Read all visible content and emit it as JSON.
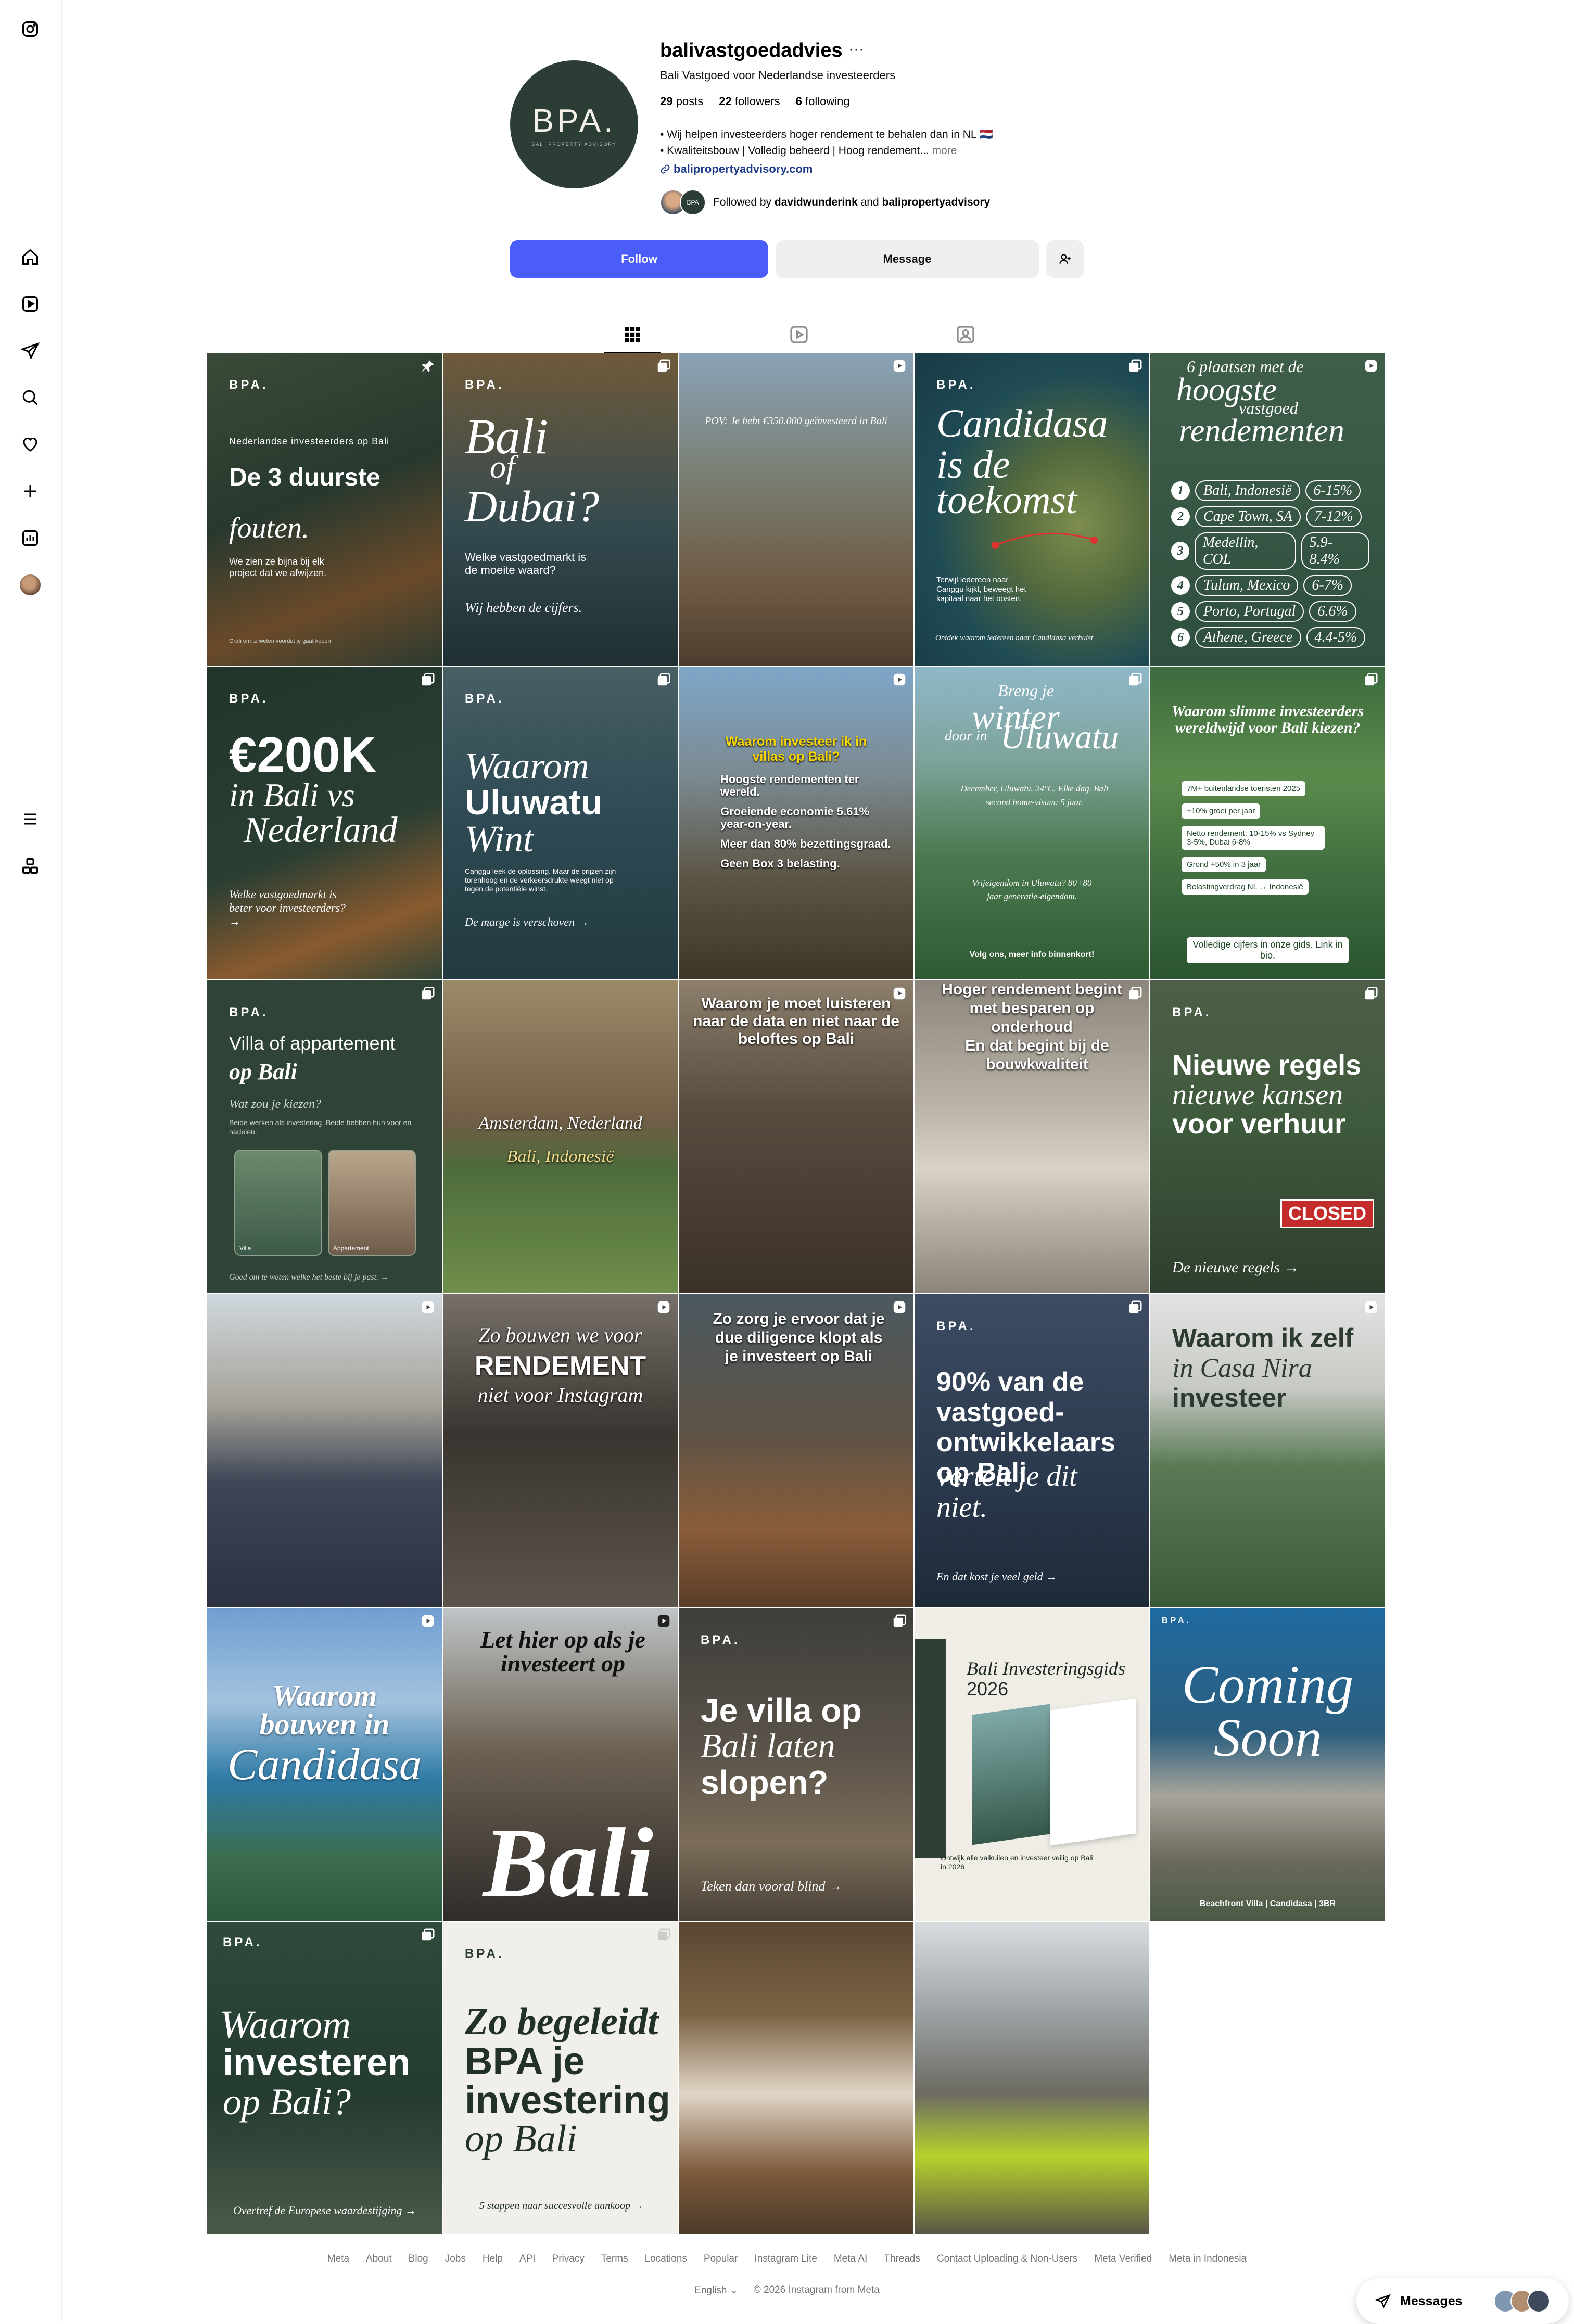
{
  "profile": {
    "username": "balivastgoedadvies",
    "full_name": "Bali Vastgoed voor Nederlandse investeerders",
    "avatar_logo": "BPA.",
    "avatar_sub": "BALI PROPERTY ADVISORY",
    "stats": [
      {
        "value": "29",
        "label": "posts"
      },
      {
        "value": "22",
        "label": "followers"
      },
      {
        "value": "6",
        "label": "following"
      }
    ],
    "bio_line1": "• Wij helpen investeerders hoger rendement te behalen dan in NL 🇳🇱",
    "bio_line2": "• Kwaliteitsbouw | Volledig beheerd | Hoog rendement...",
    "bio_more": "more",
    "link": "balipropertyadvisory.com",
    "followed_prefix": "Followed by",
    "followed_user1": "davidwunderink",
    "followed_and": "and",
    "followed_user2": "balipropertyadvisory",
    "mini_logo": "BPA"
  },
  "buttons": {
    "follow": "Follow",
    "message": "Message"
  },
  "icons": {
    "rail": [
      "instagram-icon",
      "home-icon",
      "reels-icon",
      "send-icon",
      "search-icon",
      "heart-icon",
      "create-icon",
      "dashboard-icon",
      "profile-avatar",
      "menu-icon",
      "also-from-meta-icon"
    ],
    "tabs": [
      "grid-icon",
      "reels-tab-icon",
      "tagged-icon"
    ]
  },
  "posts": [
    {
      "bpa": "BPA.",
      "kicker": "Nederlandse investeerders op Bali",
      "title": "De 3 duurste",
      "title2": "fouten.",
      "sub": "We zien ze bijna bij elk project dat we afwijzen.",
      "foot": "Grafi om te weten voordat je gaat kopen"
    },
    {
      "bpa": "BPA.",
      "title": "Bali",
      "title2": "of",
      "title3": "Dubai?",
      "sub": "Welke vastgoedmarkt is de moeite waard?",
      "foot": "Wij hebben de cijfers."
    },
    {
      "title": "POV: Je hebt €350.000 geïnvesteerd in Bali"
    },
    {
      "bpa": "BPA.",
      "title": "Candidasa",
      "title2": "is de",
      "title3": "toekomst",
      "sub": "Terwijl iedereen naar Canggu kijkt, beweegt het kapitaal naar het oosten.",
      "foot": "Ontdek waarom iedereen naar Candidasa verhuist"
    },
    {
      "title": "6 plaatsen met de",
      "title2": "hoogste",
      "title3": "vastgoed",
      "title4": "rendementen",
      "rows": [
        {
          "n": "1",
          "place": "Bali, Indonesië",
          "val": "6-15%"
        },
        {
          "n": "2",
          "place": "Cape Town, SA",
          "val": "7-12%"
        },
        {
          "n": "3",
          "place": "Medellin, COL",
          "val": "5.9-8.4%"
        },
        {
          "n": "4",
          "place": "Tulum, Mexico",
          "val": "6-7%"
        },
        {
          "n": "5",
          "place": "Porto, Portugal",
          "val": "6.6%"
        },
        {
          "n": "6",
          "place": "Athene, Greece",
          "val": "4.4-5%"
        }
      ]
    },
    {
      "bpa": "BPA.",
      "title": "€200K",
      "title2": "in Bali vs",
      "title3": "Nederland",
      "sub": "Welke vastgoedmarkt is beter voor investeerders? →"
    },
    {
      "bpa": "BPA.",
      "title": "Waarom",
      "title2": "Uluwatu",
      "title3": "Wint",
      "sub": "Canggu leek de oplossing. Maar de prijzen zijn torenhoog en de verkeersdrukte weegt niet op tegen de potentiële winst.",
      "foot": "De marge is verschoven →"
    },
    {
      "title": "Waarom investeer ik in villas op Bali?",
      "items": [
        "Hoogste rendementen ter wereld.",
        "Groeiende economie 5.61% year-on-year.",
        "Meer dan 80% bezettingsgraad.",
        "Geen Box 3 belasting."
      ]
    },
    {
      "title": "Breng je",
      "title2": "winter",
      "title3": "door in",
      "title4": "Uluwatu",
      "sub": "December, Uluwatu. 24°C. Elke dag. Bali second home-visum: 5 jaar.",
      "sub2": "Vrijeigendom in Uluwatu? 80+80 jaar generatie-eigendom.",
      "foot": "Volg ons, meer info binnenkort!"
    },
    {
      "title": "Waarom slimme investeerders wereldwijd voor Bali kiezen?",
      "items": [
        "7M+ buitenlandse toeristen 2025",
        "+10% groei per jaar",
        "Netto rendement: 10-15% vs Sydney 3-5%, Dubai 6-8%",
        "Grond +50% in 3 jaar",
        "Belastingverdrag NL ↔ Indonesië"
      ],
      "foot": "Volledige cijfers in onze gids. Link in bio."
    },
    {
      "bpa": "BPA.",
      "title": "Villa of appartement",
      "title2": "op Bali",
      "sub": "Wat zou je kiezen?",
      "sub2": "Beide werken als investering. Beide hebben hun voor en nadelen.",
      "l1": "Villa",
      "l2": "Appartement",
      "foot": "Goed om te weten welke het beste bij je past. →"
    },
    {
      "title": "Amsterdam, Nederland",
      "title2": "Bali, Indonesië"
    },
    {
      "title": "Waarom je moet luisteren naar de data en niet naar de beloftes op Bali"
    },
    {
      "title": "Hoger rendement begint met besparen op onderhoud",
      "title2": "En dat begint bij de bouwkwaliteit"
    },
    {
      "bpa": "BPA.",
      "title": "Nieuwe regels",
      "title2": "nieuwe kansen",
      "title3": "voor verhuur",
      "sign": "CLOSED",
      "foot": "De nieuwe regels →"
    },
    {},
    {
      "title": "Zo bouwen we voor",
      "title2": "RENDEMENT",
      "title3": "niet voor Instagram"
    },
    {
      "title": "Zo zorg je ervoor dat je due diligence klopt als je investeert op Bali"
    },
    {
      "bpa": "BPA.",
      "title": "90% van de vastgoed-ontwikkelaars op Bali",
      "title2": "vertelt je dit niet.",
      "foot": "En dat kost je veel geld →"
    },
    {
      "title": "Waarom ik zelf",
      "title2": "in Casa Nira",
      "title3": "investeer"
    },
    {
      "title": "Waarom",
      "title2": "bouwen in",
      "title3": "Candidasa"
    },
    {
      "title": "Let hier op als je investeert op",
      "title2": "Bali"
    },
    {
      "bpa": "BPA.",
      "title": "Je villa op",
      "title2": "Bali laten",
      "title3": "slopen?",
      "foot": "Teken dan vooral blind →"
    },
    {
      "title": "Bali Investeringsgids",
      "title2": "2026",
      "sub": "Ontwijk alle valkuilen en investeer veilig op Bali in 2026"
    },
    {
      "bpa": "BPA.",
      "title": "Coming",
      "title2": "Soon",
      "foot": "Beachfront Villa | Candidasa | 3BR"
    },
    {
      "bpa": "BPA.",
      "title": "Waarom",
      "title2": "investeren",
      "title3": "op Bali?",
      "foot": "Overtref de Europese waardestijging →"
    },
    {
      "bpa": "BPA.",
      "title": "Zo begeleidt",
      "title2": "BPA je",
      "title3": "investering",
      "title4": "op Bali",
      "foot": "5 stappen naar succesvolle aankoop →"
    },
    {},
    {}
  ],
  "footer": {
    "links": [
      "Meta",
      "About",
      "Blog",
      "Jobs",
      "Help",
      "API",
      "Privacy",
      "Terms",
      "Locations",
      "Popular",
      "Instagram Lite",
      "Meta AI",
      "Threads",
      "Contact Uploading & Non-Users",
      "Meta Verified",
      "Meta in Indonesia"
    ],
    "language": "English",
    "copyright": "© 2026 Instagram from Meta"
  },
  "messages_label": "Messages",
  "colors": {
    "accent": "#4a5df9",
    "brand_green": "#2b3d35"
  }
}
